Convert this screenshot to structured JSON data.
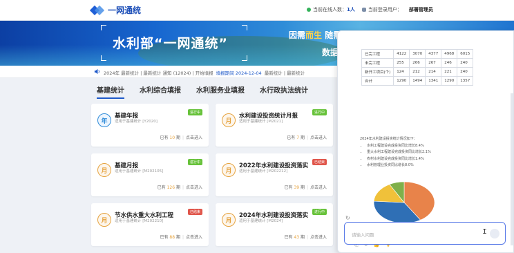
{
  "header": {
    "logo_text": "一网通统",
    "online_label": "当前在线人数：",
    "online_count": "1人",
    "user_label": "当前登录用户：",
    "user_name": "部署管理员"
  },
  "banner": {
    "title": "水利部“一网通统”",
    "sub_line1_pre": "因需",
    "sub_line1_hl": "而生",
    "sub_line1_post": "随需而变",
    "sub_line2": "数据"
  },
  "notice": {
    "text_a": "2024年 最新统计 | 最新统计 通知 (12024) | 开始填报",
    "text_blue": "填报期间 2024-12-04",
    "text_b": "最新统计 | 最新统计"
  },
  "tabs": [
    "基建统计",
    "水利综合填报",
    "水利服务业填报",
    "水行政执法统计"
  ],
  "cards": [
    {
      "icon": "年",
      "title": "基建年报",
      "src": "适用于基建统计 [Y2020]",
      "tag": "进行中",
      "tag_color": "#67c23a",
      "count": "10",
      "unit": "期",
      "action": "点击进入"
    },
    {
      "icon": "月",
      "title": "水利建设投资统计月报",
      "src": "适用于基建统计 [M2021]",
      "tag": "进行中",
      "tag_color": "#67c23a",
      "count": "7",
      "unit": "期",
      "action": "点击进入"
    },
    {
      "icon": "月",
      "title": "基建月报",
      "src": "适用于基建统计 [M202105]",
      "tag": "进行中",
      "tag_color": "#67c23a",
      "count": "126",
      "unit": "期",
      "action": "点击进入"
    },
    {
      "icon": "月",
      "title": "2022年水利建设投资落实...",
      "src": "适用于基建统计 [M202212]",
      "tag": "已结束",
      "tag_color": "#e0564b",
      "count": "39",
      "unit": "期",
      "action": "点击进入"
    },
    {
      "icon": "月",
      "title": "节水供水重大水利工程",
      "src": "适用于基建统计 [M202210]",
      "tag": "已结束",
      "tag_color": "#e0564b",
      "count": "88",
      "unit": "期",
      "action": "点击进入"
    },
    {
      "icon": "月",
      "title": "2024年水利建设投资落实...",
      "src": "适用于基建统计 [M2024]",
      "tag": "进行中",
      "tag_color": "#67c23a",
      "count": "43",
      "unit": "期",
      "action": "点击进入"
    }
  ],
  "chat": {
    "table": [
      [
        "已完工程",
        "4122",
        "3070",
        "4377",
        "4968",
        "6015"
      ],
      [
        "未完工程",
        "255",
        "266",
        "267",
        "246",
        "240"
      ],
      [
        "新开工项目(个)",
        "124",
        "212",
        "214",
        "221",
        "240"
      ],
      [
        "合计",
        "1290",
        "1494",
        "1341",
        "1290",
        "1357"
      ]
    ],
    "summary": "2024年水利建设投资统计情况如下：",
    "bullets": [
      "水利工程建设完成投资同比增长8.4%",
      "重大水利工程建设完成投资同比增长2.1%",
      "农村水利建设完成投资同比增长1.4%",
      "水利管理业投资同比增长8.0%"
    ],
    "input_placeholder": "请输入问题"
  },
  "chart_data": {
    "type": "pie",
    "values": [
      41,
      35,
      16,
      8
    ],
    "colors": [
      "#e8834a",
      "#2f6fb5",
      "#f0c13a",
      "#7fb04a"
    ],
    "title": "",
    "labels": []
  }
}
